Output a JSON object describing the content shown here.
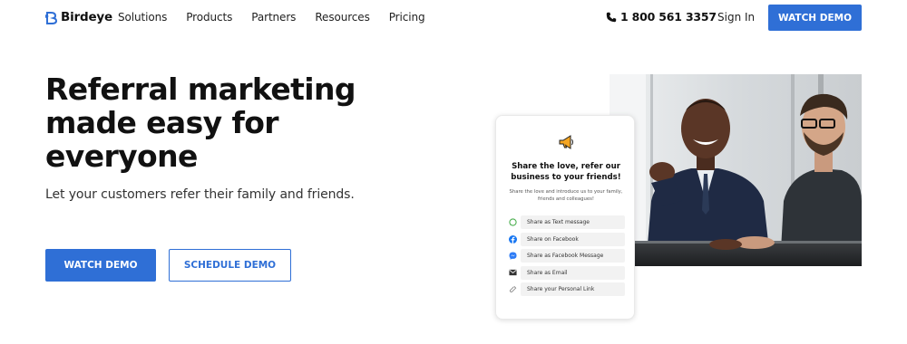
{
  "nav": {
    "logo_text": "Birdeye",
    "menu": [
      "Solutions",
      "Products",
      "Partners",
      "Resources",
      "Pricing"
    ],
    "phone": "1 800 561 3357",
    "sign_in": "Sign In",
    "cta": "WATCH DEMO"
  },
  "hero": {
    "title_lines": [
      "Referral marketing",
      "made easy for",
      "everyone"
    ],
    "subtitle": "Let your customers refer their family and friends.",
    "primary_button": "WATCH DEMO",
    "secondary_button": "SCHEDULE DEMO"
  },
  "card": {
    "icon": "megaphone-icon",
    "title": "Share the love, refer our business to your friends!",
    "description": "Share the love and introduce us to your family, friends and colleagues!",
    "items": [
      {
        "label": "Share as Text message",
        "icon": "whatsapp-icon"
      },
      {
        "label": "Share on Facebook",
        "icon": "facebook-icon"
      },
      {
        "label": "Share as Facebook Message",
        "icon": "messenger-icon"
      },
      {
        "label": "Share as Email",
        "icon": "email-icon"
      },
      {
        "label": "Share your Personal Link",
        "icon": "link-icon"
      }
    ]
  },
  "colors": {
    "brand_blue": "#2f6fd6",
    "text_dark": "#111111"
  }
}
